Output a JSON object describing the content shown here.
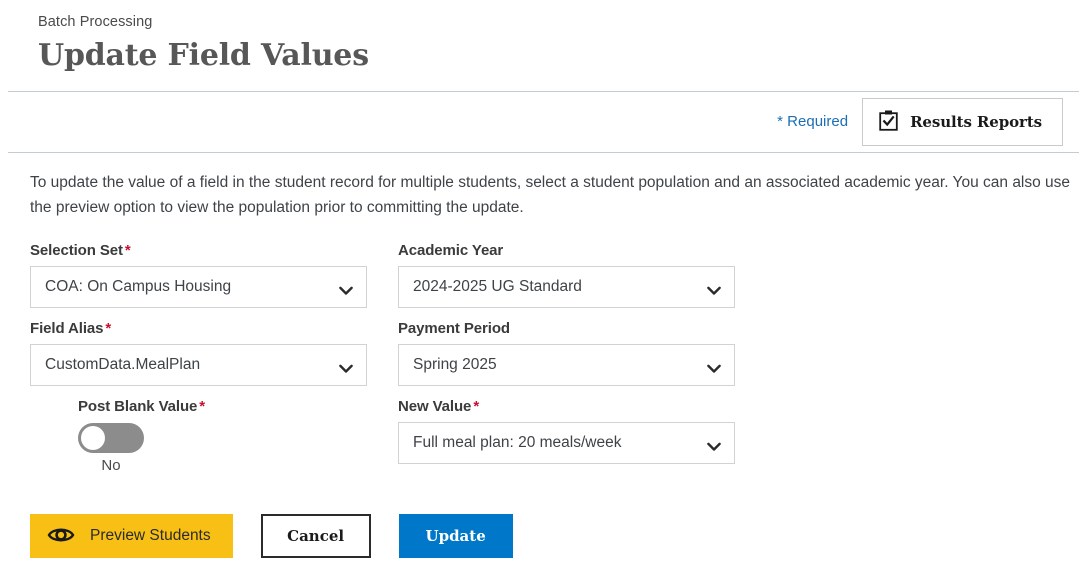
{
  "header": {
    "breadcrumb": "Batch Processing",
    "title": "Update Field Values"
  },
  "toolbar": {
    "required_note": "* Required",
    "results_reports_label": "Results Reports",
    "results_reports_icon": "clipboard-check-icon"
  },
  "description": {
    "text": "To update the value of a field in the student record for multiple students, select a student population and an associated academic year. You can also use the preview option to view the population prior to committing the update."
  },
  "form": {
    "selection_set": {
      "label": "Selection Set",
      "required_marker": "*",
      "value": "COA: On Campus Housing"
    },
    "academic_year": {
      "label": "Academic Year",
      "value": "2024-2025 UG Standard"
    },
    "field_alias": {
      "label": "Field Alias",
      "required_marker": "*",
      "value": "CustomData.MealPlan"
    },
    "payment_period": {
      "label": "Payment Period",
      "value": "Spring 2025"
    },
    "post_blank_value": {
      "label": "Post Blank Value",
      "required_marker": "*",
      "state": "No"
    },
    "new_value": {
      "label": "New Value",
      "required_marker": "*",
      "value": "Full meal plan: 20 meals/week"
    }
  },
  "buttons": {
    "preview_label": "Preview Students",
    "preview_icon": "eye-icon",
    "cancel_label": "Cancel",
    "update_label": "Update"
  },
  "colors": {
    "accent_blue": "#0077c8",
    "link_blue": "#1c6eb4",
    "required_red": "#c8102e",
    "preview_yellow": "#f8c015",
    "toggle_off_gray": "#8c8c8c"
  }
}
